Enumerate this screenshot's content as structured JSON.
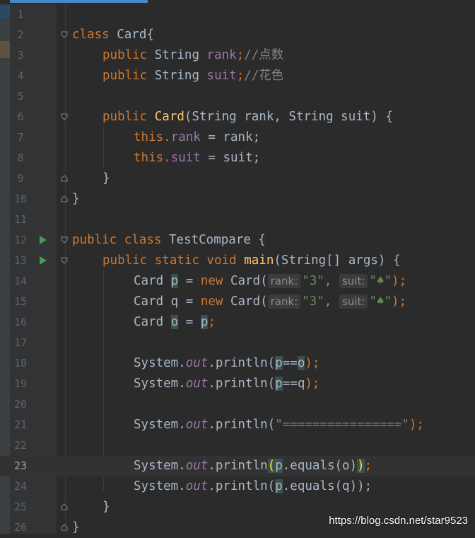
{
  "editor": {
    "lines": [
      {
        "n": "1"
      },
      {
        "n": "2",
        "kw": "class",
        "name": "Card{"
      },
      {
        "n": "3",
        "kw": "public",
        "type": "String",
        "field": "rank",
        "semi": ";",
        "comment": "//点数"
      },
      {
        "n": "4",
        "kw": "public",
        "type": "String",
        "field": "suit",
        "semi": ";",
        "comment": "//花色"
      },
      {
        "n": "5"
      },
      {
        "n": "6",
        "kw": "public",
        "ctor": "Card",
        "params": "(String rank, String suit) {"
      },
      {
        "n": "7",
        "this": "this",
        "dot": ".",
        "field": "rank",
        "rest": " = rank;"
      },
      {
        "n": "8",
        "this": "this",
        "dot": ".",
        "field": "suit",
        "rest": " = suit;"
      },
      {
        "n": "9",
        "text": "}"
      },
      {
        "n": "10",
        "text": "}"
      },
      {
        "n": "11"
      },
      {
        "n": "12",
        "kw1": "public",
        "kw2": "class",
        "name": "TestCompare {"
      },
      {
        "n": "13",
        "kw1": "public",
        "kw2": "static",
        "kw3": "void",
        "method": "main",
        "rest": "(String[] args) {"
      },
      {
        "n": "14",
        "a": "Card ",
        "v": "p",
        "b": " = ",
        "kw": "new",
        "c": " Card(",
        "h1": "rank:",
        "s1": "\"3\"",
        "comma": ",",
        "h2": "suit:",
        "s2": "\"♠\"",
        "end": ");"
      },
      {
        "n": "15",
        "a": "Card q = ",
        "kw": "new",
        "c": " Card(",
        "h1": "rank:",
        "s1": "\"3\"",
        "comma": ",",
        "h2": "suit:",
        "s2": "\"♠\"",
        "end": ");"
      },
      {
        "n": "16",
        "a": "Card ",
        "v": "o",
        "b": " = ",
        "v2": "p",
        "end": ";"
      },
      {
        "n": "17"
      },
      {
        "n": "18",
        "a": "System.",
        "out": "out",
        "b": ".println(",
        "v": "p",
        "c": "==",
        "v2": "o",
        "end": ");"
      },
      {
        "n": "19",
        "a": "System.",
        "out": "out",
        "b": ".println(",
        "v": "p",
        "c": "==q",
        "end": ");"
      },
      {
        "n": "20"
      },
      {
        "n": "21",
        "a": "System.",
        "out": "out",
        "b": ".println(",
        "s": "\"================\"",
        "end": ");"
      },
      {
        "n": "22"
      },
      {
        "n": "23",
        "a": "System.",
        "out": "out",
        "b": ".println",
        "br1": "(",
        "v": "p",
        "c": ".equals(o)",
        "br2": ")",
        "end": ";"
      },
      {
        "n": "24",
        "a": "System.",
        "out": "out",
        "b": ".println(",
        "v": "p",
        "c": ".equals(q));"
      },
      {
        "n": "25",
        "text": "}"
      },
      {
        "n": "26",
        "text": "}"
      }
    ]
  },
  "watermark": "https://blog.csdn.net/star9523",
  "colors": {
    "keyword": "#cc7832",
    "field": "#9876aa",
    "string": "#6a8759",
    "method": "#ffc66d",
    "text": "#a9b7c6"
  }
}
